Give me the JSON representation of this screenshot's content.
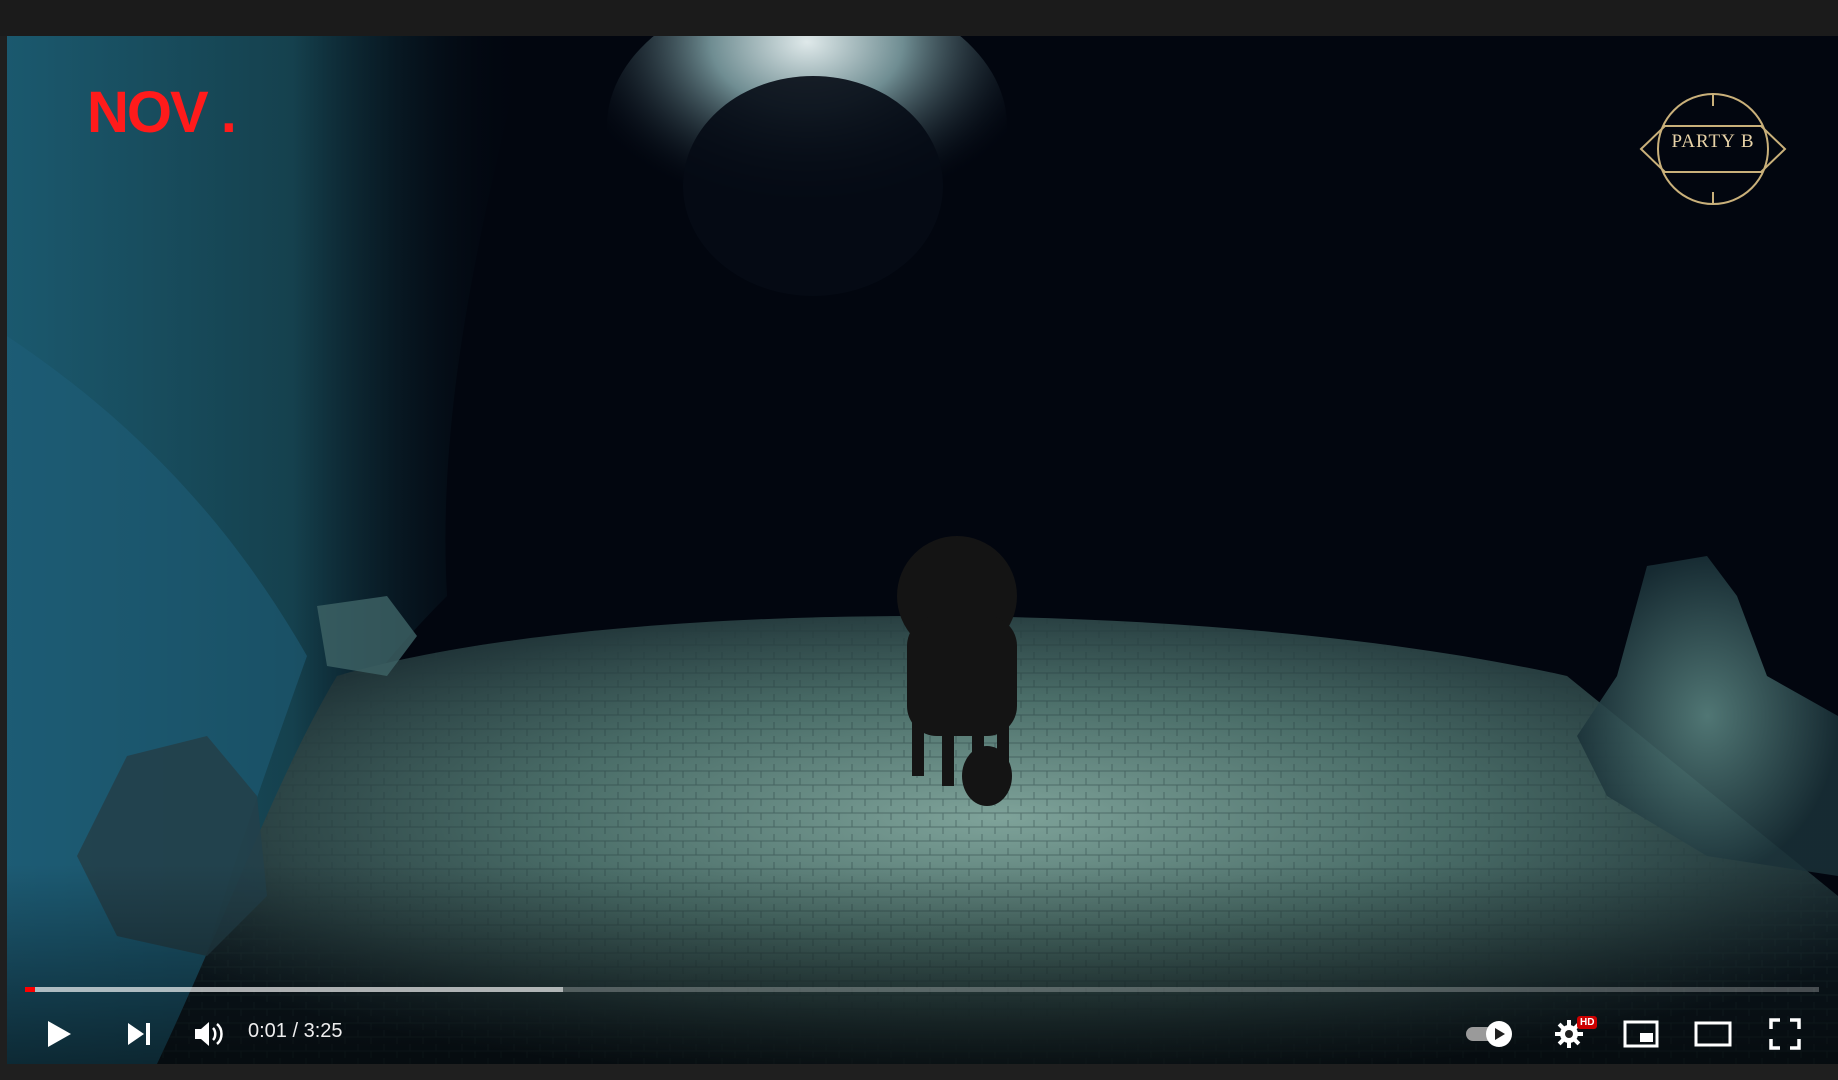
{
  "video": {
    "channel_logo_text": "NOV .",
    "badge_text": "PARTY B",
    "current_time": "0:01",
    "duration": "3:25",
    "time_display": "0:01 / 3:25",
    "played_fraction": 0.0055,
    "buffered_fraction": 0.3
  },
  "controls": {
    "play": "play-icon",
    "next": "next-icon",
    "volume": "volume-icon",
    "autoplay": "autoplay-toggle-icon",
    "settings": "gear-icon",
    "settings_badge": "HD",
    "miniplayer": "miniplayer-icon",
    "theater": "theater-icon",
    "fullscreen": "fullscreen-icon"
  },
  "colors": {
    "progress_played": "#ff0000",
    "hd_badge": "#cc0000",
    "channel_logo": "#ff1b1b",
    "badge_gold": "#e8d3a8"
  }
}
